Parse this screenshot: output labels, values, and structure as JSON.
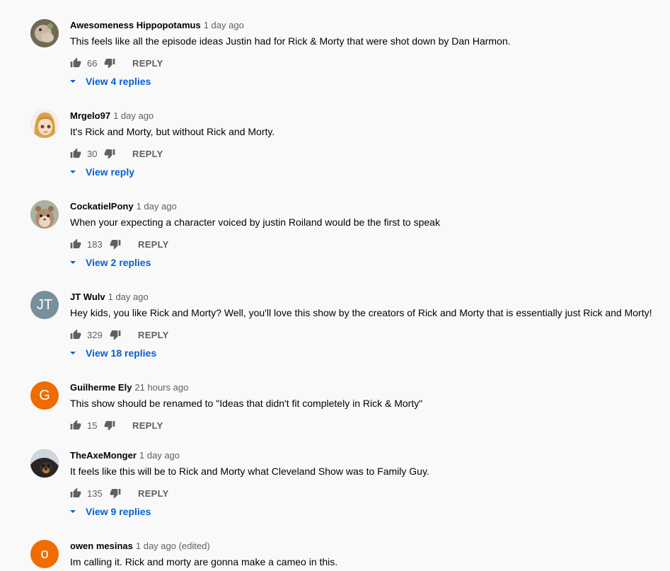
{
  "comments": [
    {
      "author": "Awesomeness Hippopotamus",
      "time": "1 day ago",
      "text": "This feels like all the episode ideas Justin had for Rick & Morty that were shot down by Dan Harmon.",
      "likes": "66",
      "reply_label": "REPLY",
      "view_replies": "View 4 replies",
      "avatar": {
        "type": "image",
        "icon": "hippo-avatar-icon",
        "color": "#8a7a6a"
      }
    },
    {
      "author": "Mrgelo97",
      "time": "1 day ago",
      "text": "It's Rick and Morty, but without Rick and Morty.",
      "likes": "30",
      "reply_label": "REPLY",
      "view_replies": "View reply",
      "avatar": {
        "type": "image",
        "icon": "anime-girl-avatar-icon",
        "color": "#e6b36a"
      }
    },
    {
      "author": "CockatielPony",
      "time": "1 day ago",
      "text": "When your expecting a character voiced by justin Roiland would be the first to speak",
      "likes": "183",
      "reply_label": "REPLY",
      "view_replies": "View 2 replies",
      "avatar": {
        "type": "image",
        "icon": "hamster-avatar-icon",
        "color": "#b89a82"
      }
    },
    {
      "author": "JT Wulv",
      "time": "1 day ago",
      "text": "Hey kids, you like Rick and Morty? Well, you'll love this show by the creators of Rick and Morty that is essentially just Rick and Morty!",
      "likes": "329",
      "reply_label": "REPLY",
      "view_replies": "View 18 replies",
      "avatar": {
        "type": "letter",
        "letter": "JT",
        "color": "#78909c"
      }
    },
    {
      "author": "Guilherme Ely",
      "time": "21 hours ago",
      "text": "This show  should be renamed to \"Ideas that didn't fit completely in Rick & Morty\"",
      "likes": "15",
      "reply_label": "REPLY",
      "view_replies": "",
      "avatar": {
        "type": "letter",
        "letter": "G",
        "color": "#ef6c00"
      }
    },
    {
      "author": "TheAxeMonger",
      "time": "1 day ago",
      "text": "It feels like this will be to Rick and Morty what Cleveland Show was to Family Guy.",
      "likes": "135",
      "reply_label": "REPLY",
      "view_replies": "View 9 replies",
      "avatar": {
        "type": "image",
        "icon": "dog-avatar-icon",
        "color": "#3a342e"
      }
    },
    {
      "author": "owen mesinas",
      "time": "1 day ago (edited)",
      "text": "Im calling it. Rick and morty are gonna make a cameo in this.",
      "likes": "",
      "reply_label": "",
      "view_replies": "",
      "avatar": {
        "type": "letter",
        "letter": "o",
        "color": "#ef6c00"
      }
    }
  ],
  "colors": {
    "background": "#f9f9f9",
    "link_blue": "#065fd4",
    "secondary_text": "#606060",
    "primary_text": "#030303"
  }
}
